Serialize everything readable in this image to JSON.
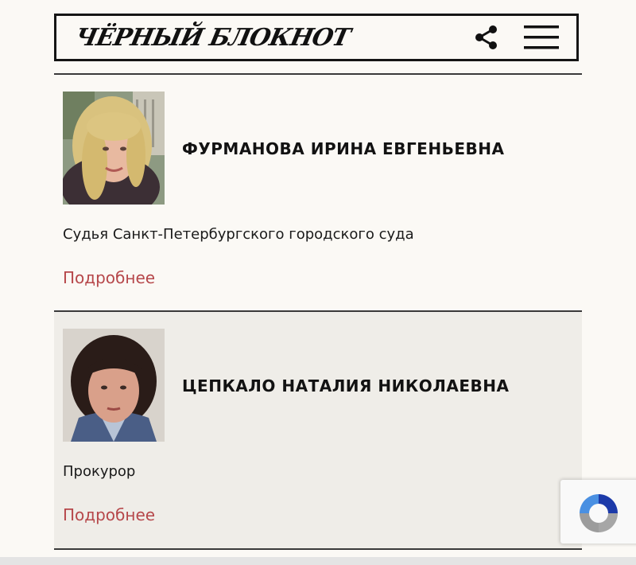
{
  "header": {
    "logo_text": "ЧЁРНЫЙ БЛОКНОТ",
    "share_icon": "share-icon",
    "menu_icon": "hamburger-menu-icon"
  },
  "people": [
    {
      "name": "ФУРМАНОВА ИРИНА ЕВГЕНЬЕВНА",
      "role": "Судья Санкт-Петербургского городского суда",
      "more": "Подробнее"
    },
    {
      "name": "ЦЕПКАЛО НАТАЛИЯ НИКОЛАЕВНА",
      "role": "Прокурор",
      "more": "Подробнее"
    }
  ],
  "colors": {
    "background": "#fbf9f5",
    "card_alt": "#efede8",
    "link": "#b6474a",
    "border": "#151515"
  }
}
